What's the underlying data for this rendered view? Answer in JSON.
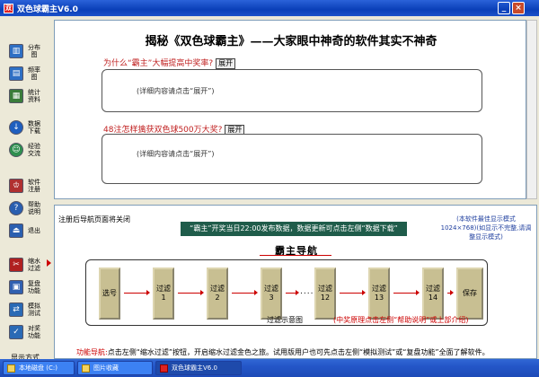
{
  "window": {
    "title": "双色球霸主V6.0",
    "icon_glyph": "双"
  },
  "sidebar": {
    "items": [
      {
        "label": "分布图",
        "icon": "distribution-chart-icon",
        "color": "#2e6fc4"
      },
      {
        "label": "频率图",
        "icon": "frequency-chart-icon",
        "color": "#2e6fc4"
      },
      {
        "label": "统计资料",
        "icon": "statistics-icon",
        "color": "#3a7c3a"
      },
      {
        "label": "数据下载",
        "icon": "download-icon",
        "color": "#1f5fbf"
      },
      {
        "label": "经验交流",
        "icon": "exchange-icon",
        "color": "#2f8f4f"
      },
      {
        "label": "软件注册",
        "icon": "register-key-icon",
        "color": "#b03030"
      },
      {
        "label": "帮助说明",
        "icon": "help-icon",
        "color": "#2a5fb0"
      },
      {
        "label": "退出",
        "icon": "exit-icon",
        "color": "#2a5fb0"
      },
      {
        "label": "缩水过滤",
        "icon": "filter-icon",
        "color": "#b02020"
      },
      {
        "label": "复盘功能",
        "icon": "replay-icon",
        "color": "#3060b0"
      },
      {
        "label": "模拟测试",
        "icon": "simulate-icon",
        "color": "#2a6ab5"
      },
      {
        "label": "对奖功能",
        "icon": "prize-check-icon",
        "color": "#2a6ab5"
      }
    ],
    "display_mode": "显示方式"
  },
  "upper": {
    "headline": "揭秘《双色球霸主》——大家眼中神奇的软件其实不神奇",
    "q1": "为什么“霸主”大幅提高中奖率?",
    "q2": "48注怎样擒获双色球500万大奖?",
    "expand_label": "展开",
    "detail_hint": "(详细内容请点击“展开”)"
  },
  "lower": {
    "close_note": "注册后导航页面将关闭",
    "news": "“霸主”开奖当日22:00发布数据，数据更新可点击左侧“数据下载”",
    "resolution_note": "(本软件最佳显示模式1024×768)(如显示不完整,请调整显示模式)",
    "nav_title": "霸主导航",
    "steps": {
      "first": "选号",
      "filter_word": "过滤",
      "n1": "1",
      "n2": "2",
      "n3": "3",
      "n12": "12",
      "n13": "13",
      "n14": "14",
      "last": "保存"
    },
    "dots": "......",
    "flow_caption": "过滤示意图",
    "flow_hint": "(中奖原理点击左侧“帮助说明”或上部介绍)",
    "func_key": "功能导航:",
    "func_text": "点击左侧“缩水过滤”按钮，开启缩水过滤金色之旅。试用版用户也可先点击左侧“模拟测试”或“复盘功能”全面了解软件。"
  },
  "taskbar": {
    "items": [
      "本地磁盘 (C:)",
      "图片收藏",
      "双色球霸主V6.0"
    ]
  },
  "colors": {
    "title_bar": "#0a3fb8",
    "accent_red": "#c02020",
    "news_bar": "#1f5c4a",
    "step_fill": "#c8bf92"
  }
}
